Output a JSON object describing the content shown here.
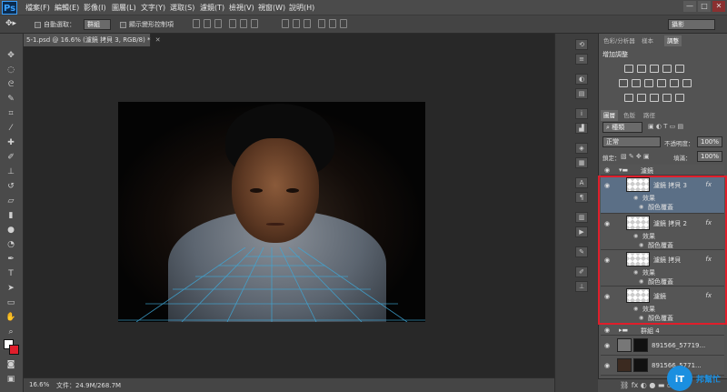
{
  "app": {
    "logo": "Ps"
  },
  "menu": [
    "檔案(F)",
    "編輯(E)",
    "影像(I)",
    "圖層(L)",
    "文字(Y)",
    "選取(S)",
    "濾鏡(T)",
    "檢視(V)",
    "視窗(W)",
    "說明(H)"
  ],
  "window_buttons": [
    "—",
    "□",
    "✕"
  ],
  "options": {
    "auto_select_label": "自動選取：",
    "auto_select_value": "群組",
    "show_transform_label": "顯示變形控制項",
    "workspace": "攝影"
  },
  "document": {
    "tab_title": "5-1.psd @ 16.6% (濾鏡 拷貝 3, RGB/8) *"
  },
  "status": {
    "zoom": "16.6%",
    "doc_size": "文件：24.9M/268.7M"
  },
  "panels": {
    "top_tabs": [
      "色彩/分析器",
      "樣本",
      "調整"
    ],
    "top_active": "調整",
    "adjust_title": "增加調整",
    "layers_tabs": [
      "圖層",
      "色版",
      "路徑"
    ],
    "kind_filter": "種類",
    "blend_mode": "正常",
    "opacity_label": "不透明度：",
    "opacity": "100%",
    "lock_label": "鎖定：",
    "fill_label": "填滿：",
    "fill": "100%"
  },
  "layers": {
    "group_top": "濾鏡",
    "items": [
      {
        "name": "濾鏡 拷貝 3",
        "effects": "效果",
        "effect_item": "顏色覆蓋",
        "fx": "fx"
      },
      {
        "name": "濾鏡 拷貝 2",
        "effects": "效果",
        "effect_item": "顏色覆蓋",
        "fx": "fx"
      },
      {
        "name": "濾鏡 拷貝",
        "effects": "效果",
        "effect_item": "顏色覆蓋",
        "fx": "fx"
      },
      {
        "name": "濾鏡",
        "effects": "效果",
        "effect_item": "顏色覆蓋",
        "fx": "fx"
      }
    ],
    "group_4": "群組 4",
    "layer_a": "891566_57719...",
    "layer_b": "891566_5771..."
  },
  "watermark": {
    "brand": "IT邦幫忙"
  },
  "colors": {
    "accent_red": "#e01e2b",
    "ps_blue": "#3aa1ff",
    "selected_row": "#5b6f86"
  }
}
